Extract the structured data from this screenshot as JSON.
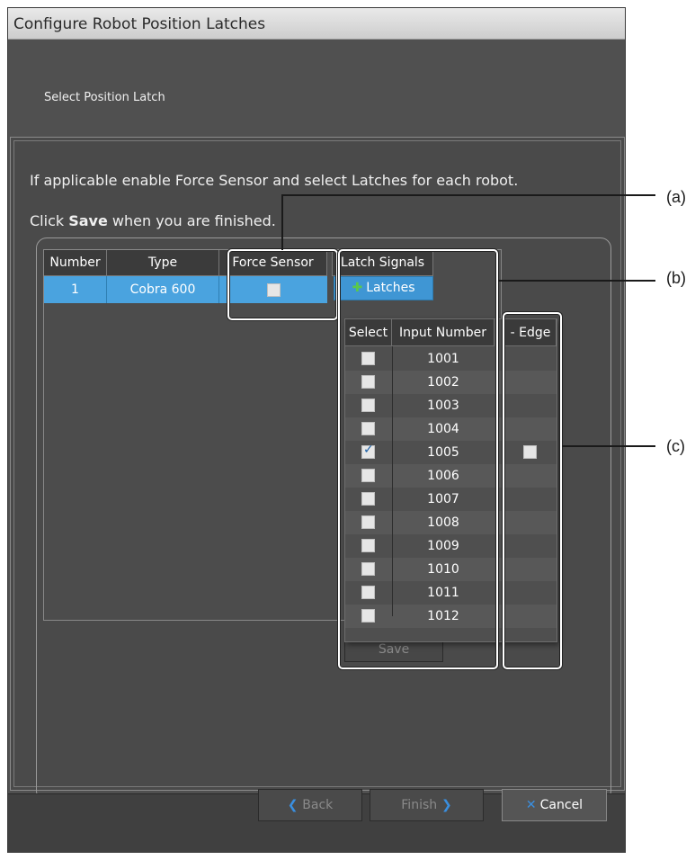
{
  "window": {
    "title": "Configure Robot Position Latches"
  },
  "step_label": "Select Position Latch",
  "instructions": {
    "line1": "If applicable enable Force Sensor and select Latches for each robot.",
    "line2_prefix": "Click ",
    "line2_bold": "Save",
    "line2_suffix": " when you are finished."
  },
  "robot_table": {
    "headers": {
      "number": "Number",
      "type": "Type",
      "force_sensor": "Force Sensor",
      "latch_signals": "Latch Signals"
    },
    "row": {
      "number": "1",
      "type": "Cobra 600",
      "force_sensor_checked": false
    },
    "latches_button": "Latches"
  },
  "latch_popup": {
    "headers": {
      "select": "Select",
      "input_number": "Input Number",
      "edge": "- Edge"
    },
    "rows": [
      {
        "input": "1001",
        "selected": false
      },
      {
        "input": "1002",
        "selected": false
      },
      {
        "input": "1003",
        "selected": false
      },
      {
        "input": "1004",
        "selected": false
      },
      {
        "input": "1005",
        "selected": true,
        "edge": false
      },
      {
        "input": "1006",
        "selected": false
      },
      {
        "input": "1007",
        "selected": false
      },
      {
        "input": "1008",
        "selected": false
      },
      {
        "input": "1009",
        "selected": false
      },
      {
        "input": "1010",
        "selected": false
      },
      {
        "input": "1011",
        "selected": false
      },
      {
        "input": "1012",
        "selected": false
      }
    ]
  },
  "save_label": "Save",
  "footer": {
    "back": "Back",
    "finish": "Finish",
    "cancel": "Cancel"
  },
  "callouts": {
    "a": "(a)",
    "b": "(b)",
    "c": "(c)"
  },
  "colors": {
    "selection_blue": "#4aa3df",
    "window_gray": "#505050",
    "accent_blue": "#3a8fe0"
  }
}
